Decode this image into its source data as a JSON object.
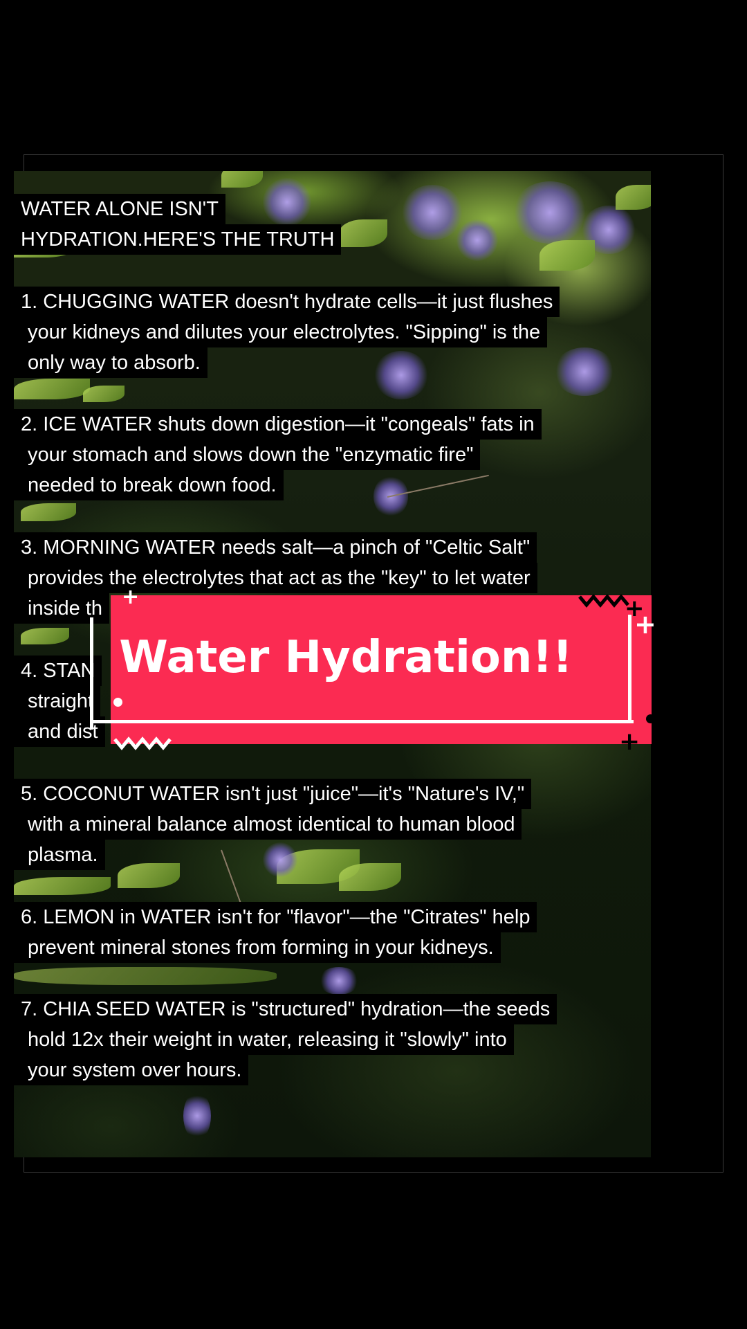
{
  "title": {
    "lines": [
      "WATER ALONE ISN'T",
      "HYDRATION.HERE'S THE TRUTH"
    ]
  },
  "tips": [
    {
      "lines": [
        "1. CHUGGING WATER doesn't hydrate cells—it just flushes",
        "your kidneys and dilutes your electrolytes. \"Sipping\" is the",
        "only way to absorb."
      ]
    },
    {
      "lines": [
        "2. ICE WATER shuts down digestion—it \"congeals\" fats in",
        "your stomach and slows down the \"enzymatic fire\"",
        "needed to break down food."
      ]
    },
    {
      "lines": [
        "3. MORNING WATER needs salt—a pinch of \"Celtic Salt\"",
        "provides the electrolytes that act as the \"key\" to let water",
        "inside th"
      ]
    },
    {
      "lines": [
        "4. STAN",
        "straight",
        "and dist"
      ]
    },
    {
      "lines": [
        "5. COCONUT WATER isn't just \"juice\"—it's \"Nature's IV,\"",
        "with a mineral balance almost identical to human blood",
        "plasma."
      ]
    },
    {
      "lines": [
        "6. LEMON in WATER isn't for \"flavor\"—the \"Citrates\" help",
        "prevent mineral stones from forming in your kidneys."
      ]
    },
    {
      "lines": [
        "7. CHIA SEED WATER is \"structured\" hydration—the seeds",
        "hold 12x their weight in water, releasing it \"slowly\" into",
        "your system over hours."
      ]
    }
  ],
  "banner": {
    "text": "Water Hydration!!",
    "color": "#fb2b52"
  },
  "icons": {
    "decorations": [
      "plus-icon",
      "zigzag-icon",
      "dot-icon"
    ]
  }
}
